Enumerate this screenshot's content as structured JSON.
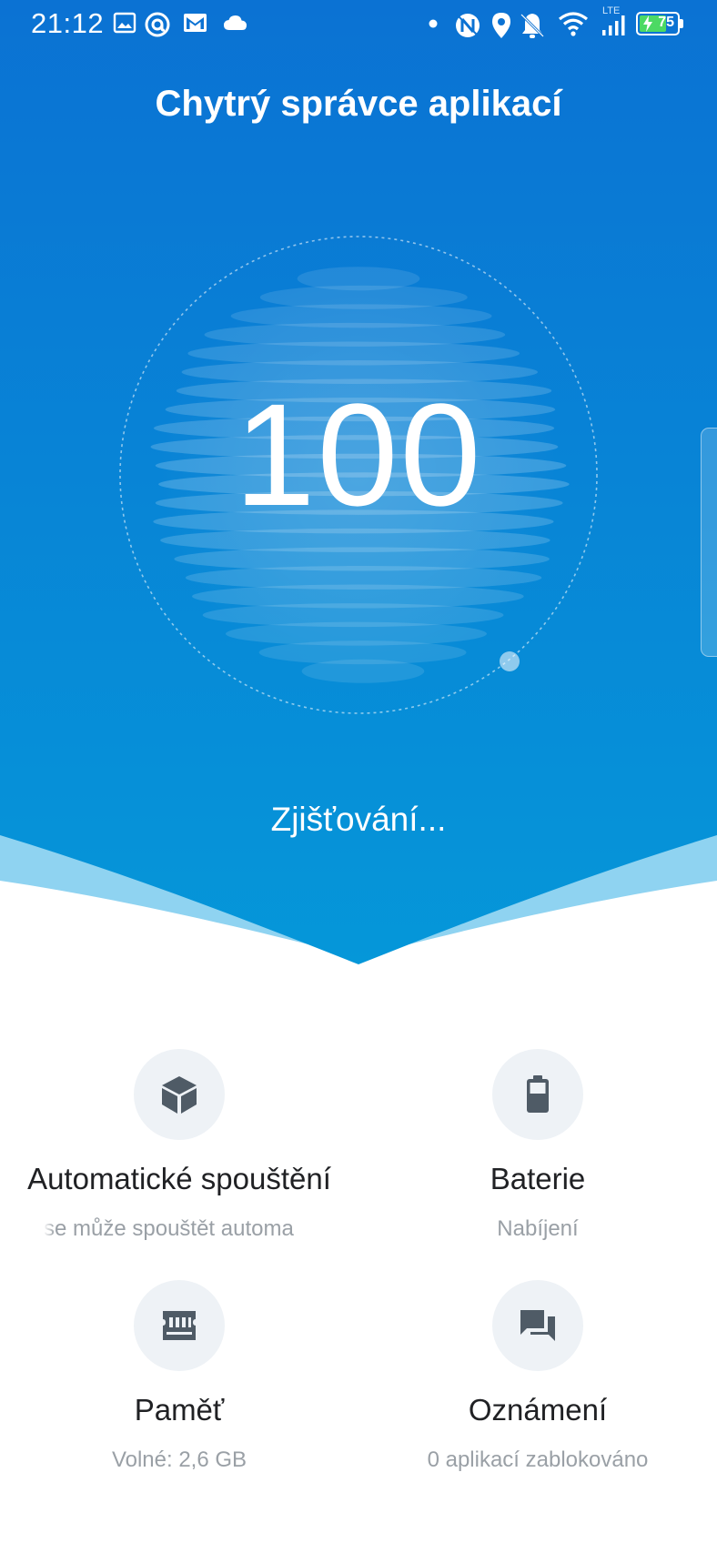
{
  "status_bar": {
    "time": "21:12",
    "network_label": "LTE",
    "battery_level": "75",
    "left_icons": [
      "image-icon",
      "at-sign-icon",
      "mail-icon",
      "cloud-icon"
    ],
    "right_icons": [
      "dot-icon",
      "nfc-icon",
      "location-icon",
      "bell-off-icon",
      "wifi-icon",
      "signal-icon",
      "battery-charging-icon"
    ]
  },
  "header": {
    "title": "Chytrý správce aplikací"
  },
  "score": {
    "value": "100",
    "status": "Zjišťování..."
  },
  "cards": [
    {
      "id": "autostart",
      "icon": "cube-icon",
      "title": "Automatické spouštění",
      "subtitle": "se může spouštět automa"
    },
    {
      "id": "battery",
      "icon": "battery-icon",
      "title": "Baterie",
      "subtitle": "Nabíjení"
    },
    {
      "id": "memory",
      "icon": "memory-chip-icon",
      "title": "Paměť",
      "subtitle": "Volné: 2,6 GB"
    },
    {
      "id": "notifications",
      "icon": "chat-bubbles-icon",
      "title": "Oznámení",
      "subtitle": "0 aplikací zablokováno"
    }
  ],
  "colors": {
    "hero_top": "#0b72d3",
    "hero_bottom": "#0597d9",
    "wave_light": "#8fd3f1",
    "icon_bg": "#eef2f6",
    "icon_fg": "#4f5b66",
    "title_text": "#202124",
    "subtitle_text": "#9aa0a6"
  }
}
